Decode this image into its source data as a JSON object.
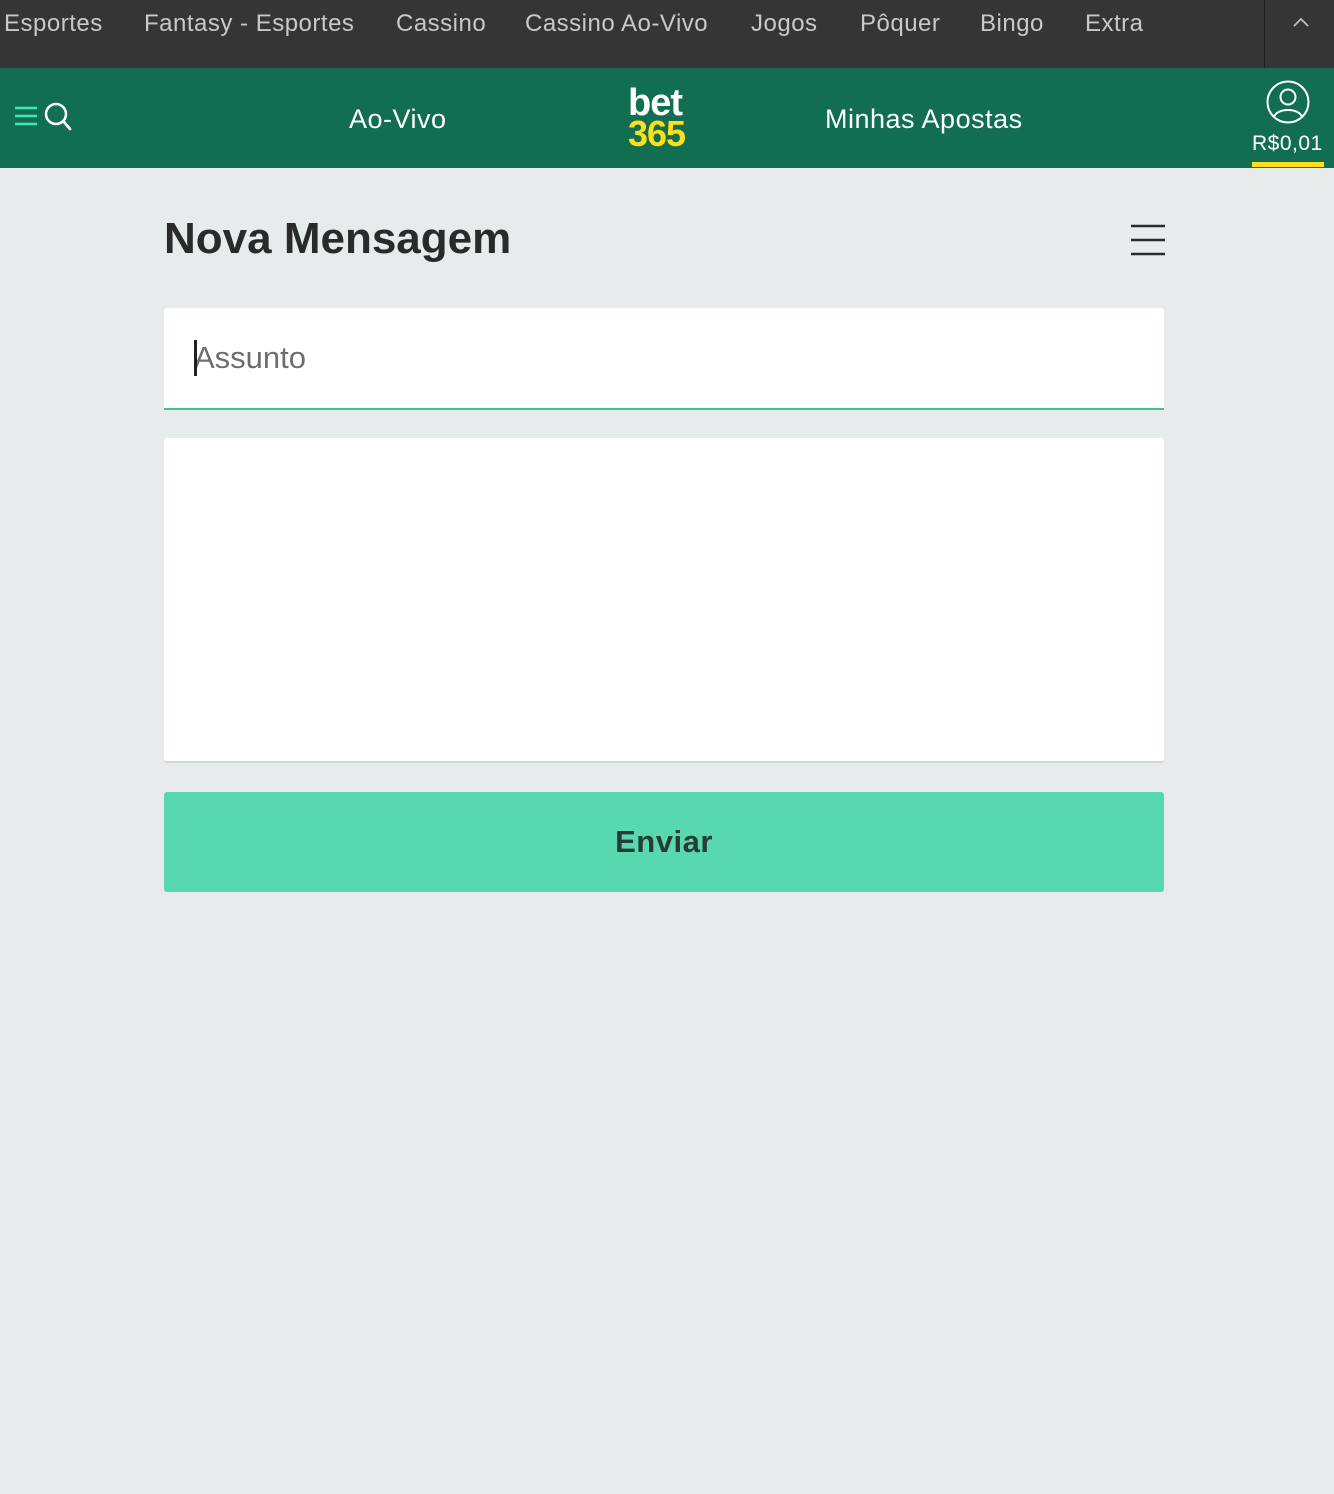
{
  "topnav": {
    "items": [
      "Esportes",
      "Fantasy - Esportes",
      "Cassino",
      "Cassino Ao-Vivo",
      "Jogos",
      "Pôquer",
      "Bingo",
      "Extra"
    ]
  },
  "header": {
    "live_label": "Ao-Vivo",
    "my_bets_label": "Minhas Apostas",
    "logo_top": "bet",
    "logo_bottom": "365",
    "balance": "R$0,01"
  },
  "page": {
    "title": "Nova Mensagem"
  },
  "form": {
    "subject_placeholder": "Assunto",
    "subject_value": "",
    "message_value": "",
    "send_label": "Enviar"
  },
  "colors": {
    "topnav_bg": "#353535",
    "header_bg": "#126e51",
    "accent_green": "#57d8ae",
    "logo_yellow": "#ffdf1b",
    "page_bg": "#e7ebec"
  }
}
